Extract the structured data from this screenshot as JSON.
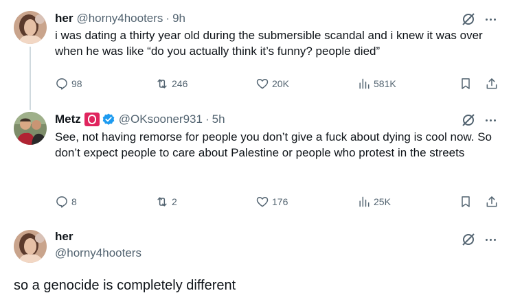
{
  "tweet1": {
    "name": "her",
    "handle": "@horny4hooters",
    "dot": "·",
    "time": "9h",
    "text": "i was dating a thirty year old during the submersible scandal and i knew it was over when he was like “do you actually think it’s funny? people died”",
    "replies": "98",
    "reposts": "246",
    "likes": "20K",
    "views": "581K"
  },
  "tweet2": {
    "name": "Metz",
    "handle": "@OKsooner931",
    "dot": "·",
    "time": "5h",
    "text": "See, not having remorse for people you don’t give a fuck about dying is cool now. So don’t expect people to care about Palestine or people who protest in the streets",
    "replies": "8",
    "reposts": "2",
    "likes": "176",
    "views": "25K"
  },
  "main_tweet": {
    "name": "her",
    "handle": "@horny4hooters",
    "text": "so a genocide is completely different"
  },
  "colors": {
    "text": "#0f1419",
    "secondary": "#536471",
    "verified": "#1d9bf0",
    "badge": "#e0245e",
    "thread_line": "#cfd9de"
  },
  "icons": [
    "reply-icon",
    "repost-icon",
    "like-icon",
    "views-icon",
    "bookmark-icon",
    "share-icon",
    "grok-icon",
    "more-icon",
    "verified-badge-icon"
  ]
}
